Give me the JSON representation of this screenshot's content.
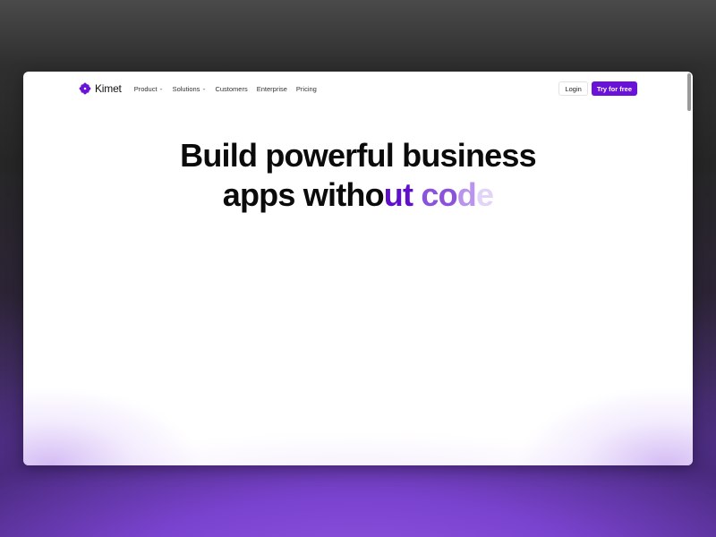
{
  "nav": {
    "brand": "Kimet",
    "links": [
      {
        "label": "Product",
        "has_dropdown": true
      },
      {
        "label": "Solutions",
        "has_dropdown": true
      },
      {
        "label": "Customers",
        "has_dropdown": false
      },
      {
        "label": "Enterprise",
        "has_dropdown": false
      },
      {
        "label": "Pricing",
        "has_dropdown": false
      }
    ],
    "chevron": "⌄",
    "login_label": "Login",
    "cta_label": "Try for free"
  },
  "hero": {
    "line1": "Build powerful business",
    "line2_a": "apps witho",
    "line2_b": "ut",
    "line2_c": " co",
    "line2_d": "d",
    "line2_e": "e"
  },
  "colors": {
    "accent": "#6a12d8",
    "text": "#0b0b0b",
    "background_gradient_end": "#7c46d6"
  },
  "icons": {
    "logo": "kimet-flower-logo-icon",
    "dropdown": "chevron-down-icon"
  }
}
